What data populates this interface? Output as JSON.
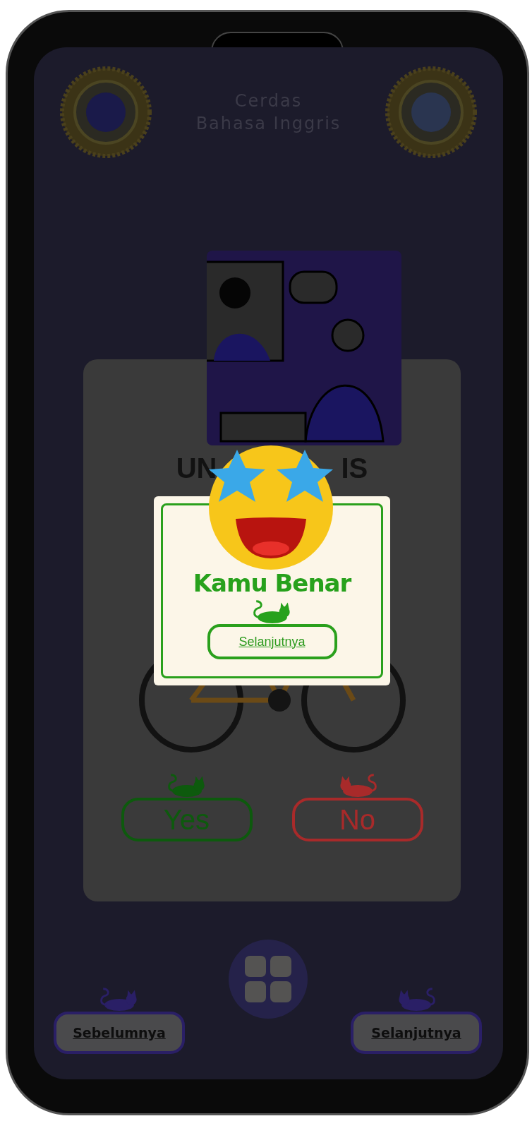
{
  "header": {
    "title_lines": [
      "Cerdas",
      "Bahasa Inggris"
    ]
  },
  "card": {
    "heading_parts": [
      "UN",
      "IS"
    ],
    "answers": [
      {
        "label": "Yes",
        "kind": "yes"
      },
      {
        "label": "No",
        "kind": "no"
      }
    ]
  },
  "dialog": {
    "message": "Kamu Benar",
    "button": "Selanjutnya"
  },
  "navigation": {
    "previous": "Sebelumnya",
    "next": "Selanjutnya"
  }
}
